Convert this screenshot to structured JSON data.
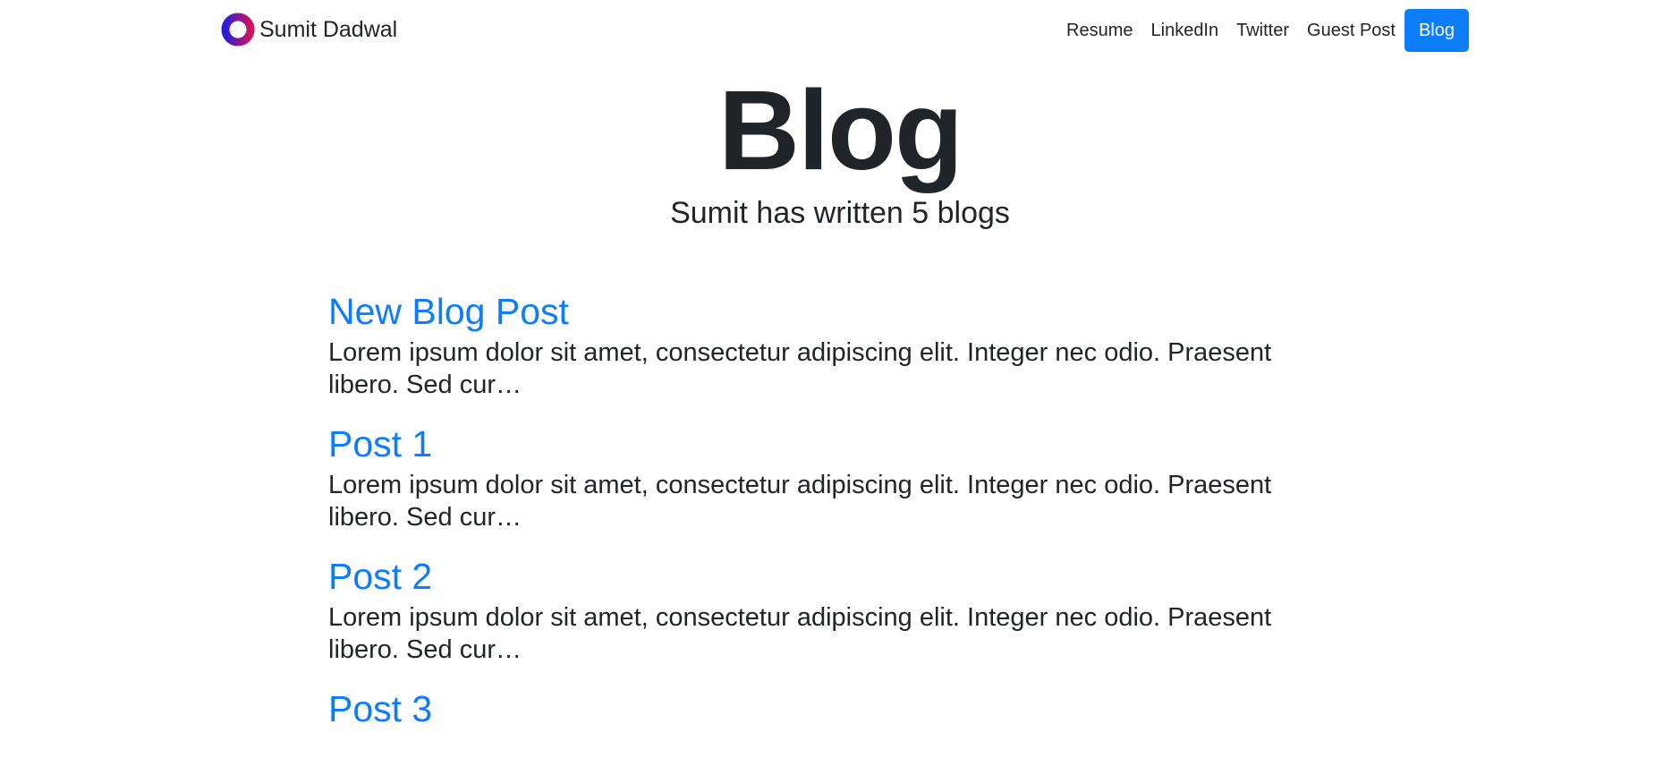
{
  "brand": {
    "name": "Sumit Dadwal",
    "logo_icon": "ring-logo-icon",
    "logo_colors": [
      "#2b1bd6",
      "#d3125a"
    ]
  },
  "nav": {
    "items": [
      {
        "label": "Resume",
        "active": false
      },
      {
        "label": "LinkedIn",
        "active": false
      },
      {
        "label": "Twitter",
        "active": false
      },
      {
        "label": "Guest Post",
        "active": false
      },
      {
        "label": "Blog",
        "active": true
      }
    ]
  },
  "hero": {
    "title": "Blog",
    "subtitle": "Sumit has written 5 blogs"
  },
  "posts": [
    {
      "title": "New Blog Post",
      "excerpt": "Lorem ipsum dolor sit amet, consectetur adipiscing elit. Integer nec odio. Praesent libero. Sed cur…"
    },
    {
      "title": "Post 1",
      "excerpt": "Lorem ipsum dolor sit amet, consectetur adipiscing elit. Integer nec odio. Praesent libero. Sed cur…"
    },
    {
      "title": "Post 2",
      "excerpt": "Lorem ipsum dolor sit amet, consectetur adipiscing elit. Integer nec odio. Praesent libero. Sed cur…"
    },
    {
      "title": "Post 3",
      "excerpt": ""
    }
  ],
  "colors": {
    "accent": "#0d7dfa",
    "text": "#212529",
    "background": "#ffffff"
  }
}
